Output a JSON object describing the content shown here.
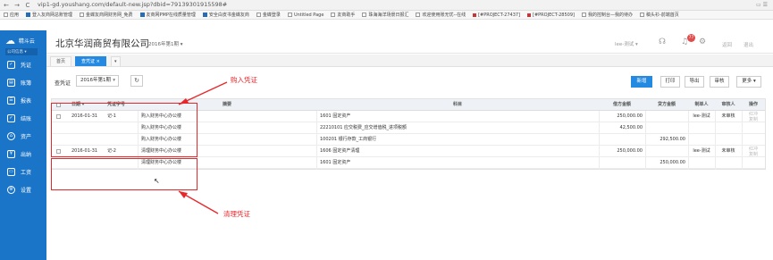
{
  "browser": {
    "url": "vip1-gd.youshang.com/default-new.jsp?dbid=79139301915598#",
    "back": "←",
    "forward": "→",
    "reload": "C",
    "bookmarks": [
      {
        "label": "应用"
      },
      {
        "label": "登入友商网总账管理"
      },
      {
        "label": "金蝶友商网财务网_免费"
      },
      {
        "label": "友商网PMP在线质量管理"
      },
      {
        "label": "安全白皮书金蝶友商"
      },
      {
        "label": "金蝶登录"
      },
      {
        "label": "Untitled Page"
      },
      {
        "label": "友商助手"
      },
      {
        "label": "珠海海洋场景日报汇"
      },
      {
        "label": "欢迎使用账无忧--在线"
      },
      {
        "label": "[#PROJECT-27437]"
      },
      {
        "label": "[#PROJECT-28509]"
      },
      {
        "label": "我的控制台—我的待办"
      },
      {
        "label": "稿头衫-前端首页"
      }
    ]
  },
  "sidebar": {
    "brand": "精斗云",
    "org": "公司信息 ▾",
    "items": [
      {
        "label": "凭证",
        "icon": "voucher-icon"
      },
      {
        "label": "账簿",
        "icon": "ledger-icon"
      },
      {
        "label": "报表",
        "icon": "report-icon"
      },
      {
        "label": "结账",
        "icon": "closing-icon"
      },
      {
        "label": "资产",
        "icon": "asset-icon"
      },
      {
        "label": "出纳",
        "icon": "cashier-icon"
      },
      {
        "label": "工资",
        "icon": "salary-icon"
      },
      {
        "label": "设置",
        "icon": "settings-icon"
      }
    ]
  },
  "header": {
    "company": "北京华润商贸有限公司",
    "period": "2016年第1期 ▾",
    "user": "lee-测试 ▾",
    "badge": "77",
    "return_label": "返回",
    "exit_label": "退出"
  },
  "tabs": [
    {
      "label": "首页",
      "active": false
    },
    {
      "label": "查凭证 ×",
      "active": true
    },
    {
      "label": "▾",
      "active": false
    }
  ],
  "toolbar": {
    "label": "查凭证",
    "period_value": "2016年第1期",
    "refresh": "↻",
    "buttons": [
      "新增",
      "打印",
      "导出",
      "审核",
      "更多 ▾"
    ]
  },
  "table": {
    "headers": [
      "日期 ▾",
      "凭证字号",
      "摘要",
      "科目",
      "借方金额",
      "贷方金额",
      "制单人",
      "审核人",
      "操作"
    ],
    "vouchers": [
      {
        "date": "2016-01-31",
        "number": "记-1",
        "maker": "lee-测试",
        "status": "未审核",
        "action": "红冲\n复制",
        "lines": [
          {
            "summary": "购入财务中心办公楼",
            "account": "1601 固定资产",
            "debit": "250,000.00",
            "credit": ""
          },
          {
            "summary": "购入财务中心办公楼",
            "account": "22210101 应交税费_应交增值税_进项税额",
            "debit": "42,500.00",
            "credit": ""
          },
          {
            "summary": "购入财务中心办公楼",
            "account": "100201 银行存款_工商银行",
            "debit": "",
            "credit": "292,500.00"
          }
        ]
      },
      {
        "date": "2016-01-31",
        "number": "记-2",
        "maker": "lee-测试",
        "status": "未审核",
        "action": "红冲\n复制",
        "lines": [
          {
            "summary": "清理财务中心办公楼",
            "account": "1606 固定资产清理",
            "debit": "250,000.00",
            "credit": ""
          },
          {
            "summary": "清理财务中心办公楼",
            "account": "1601 固定资产",
            "debit": "",
            "credit": "250,000.00"
          }
        ]
      }
    ]
  },
  "annotations": {
    "purchase": "购入凭证",
    "cleanup": "清理凭证"
  },
  "colors": {
    "sidebar": "#1a74c7",
    "primary": "#2489e0",
    "annotation": "#e8272a"
  }
}
